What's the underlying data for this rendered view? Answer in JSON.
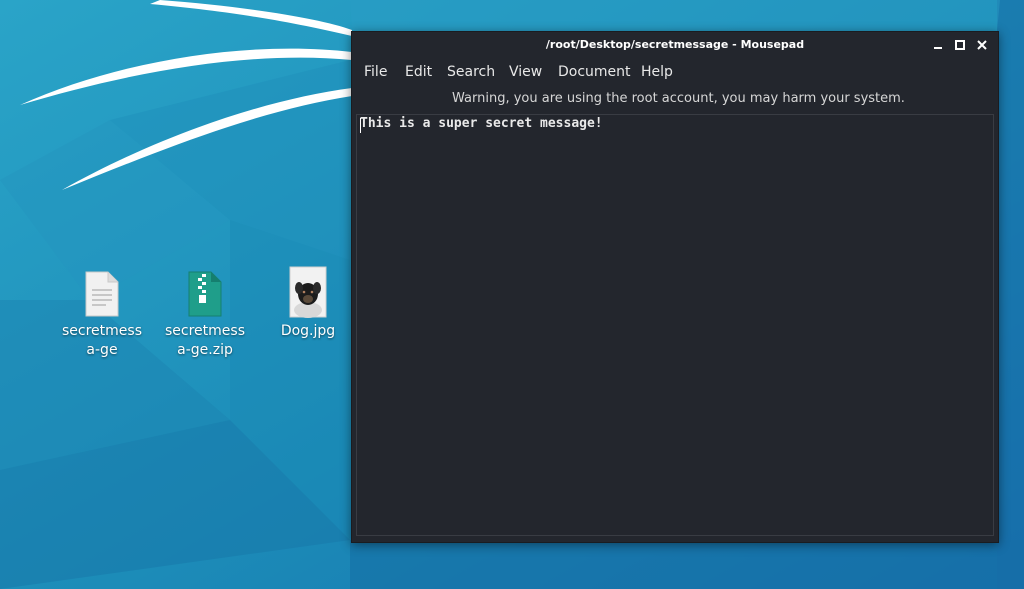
{
  "window": {
    "title": "/root/Desktop/secretmessage - Mousepad",
    "controls": {
      "minimize": "minimize-icon",
      "maximize": "maximize-icon",
      "close": "close-icon"
    }
  },
  "menu": {
    "items": [
      "File",
      "Edit",
      "Search",
      "View",
      "Document",
      "Help"
    ]
  },
  "infobar": {
    "warning": "Warning, you are using the root account, you may harm your system."
  },
  "editor": {
    "content": "This is a super secret message!"
  },
  "desktop": {
    "icons": [
      {
        "label": "secretmessa-ge",
        "icon": "text-file-icon"
      },
      {
        "label": "secretmessa-ge.zip",
        "icon": "zip-archive-icon"
      },
      {
        "label": "Dog.jpg",
        "icon": "image-thumbnail-icon"
      }
    ]
  },
  "colors": {
    "wallpaper": "#1f8fb8",
    "window_bg": "#23262d",
    "text": "#e9e9e9"
  }
}
